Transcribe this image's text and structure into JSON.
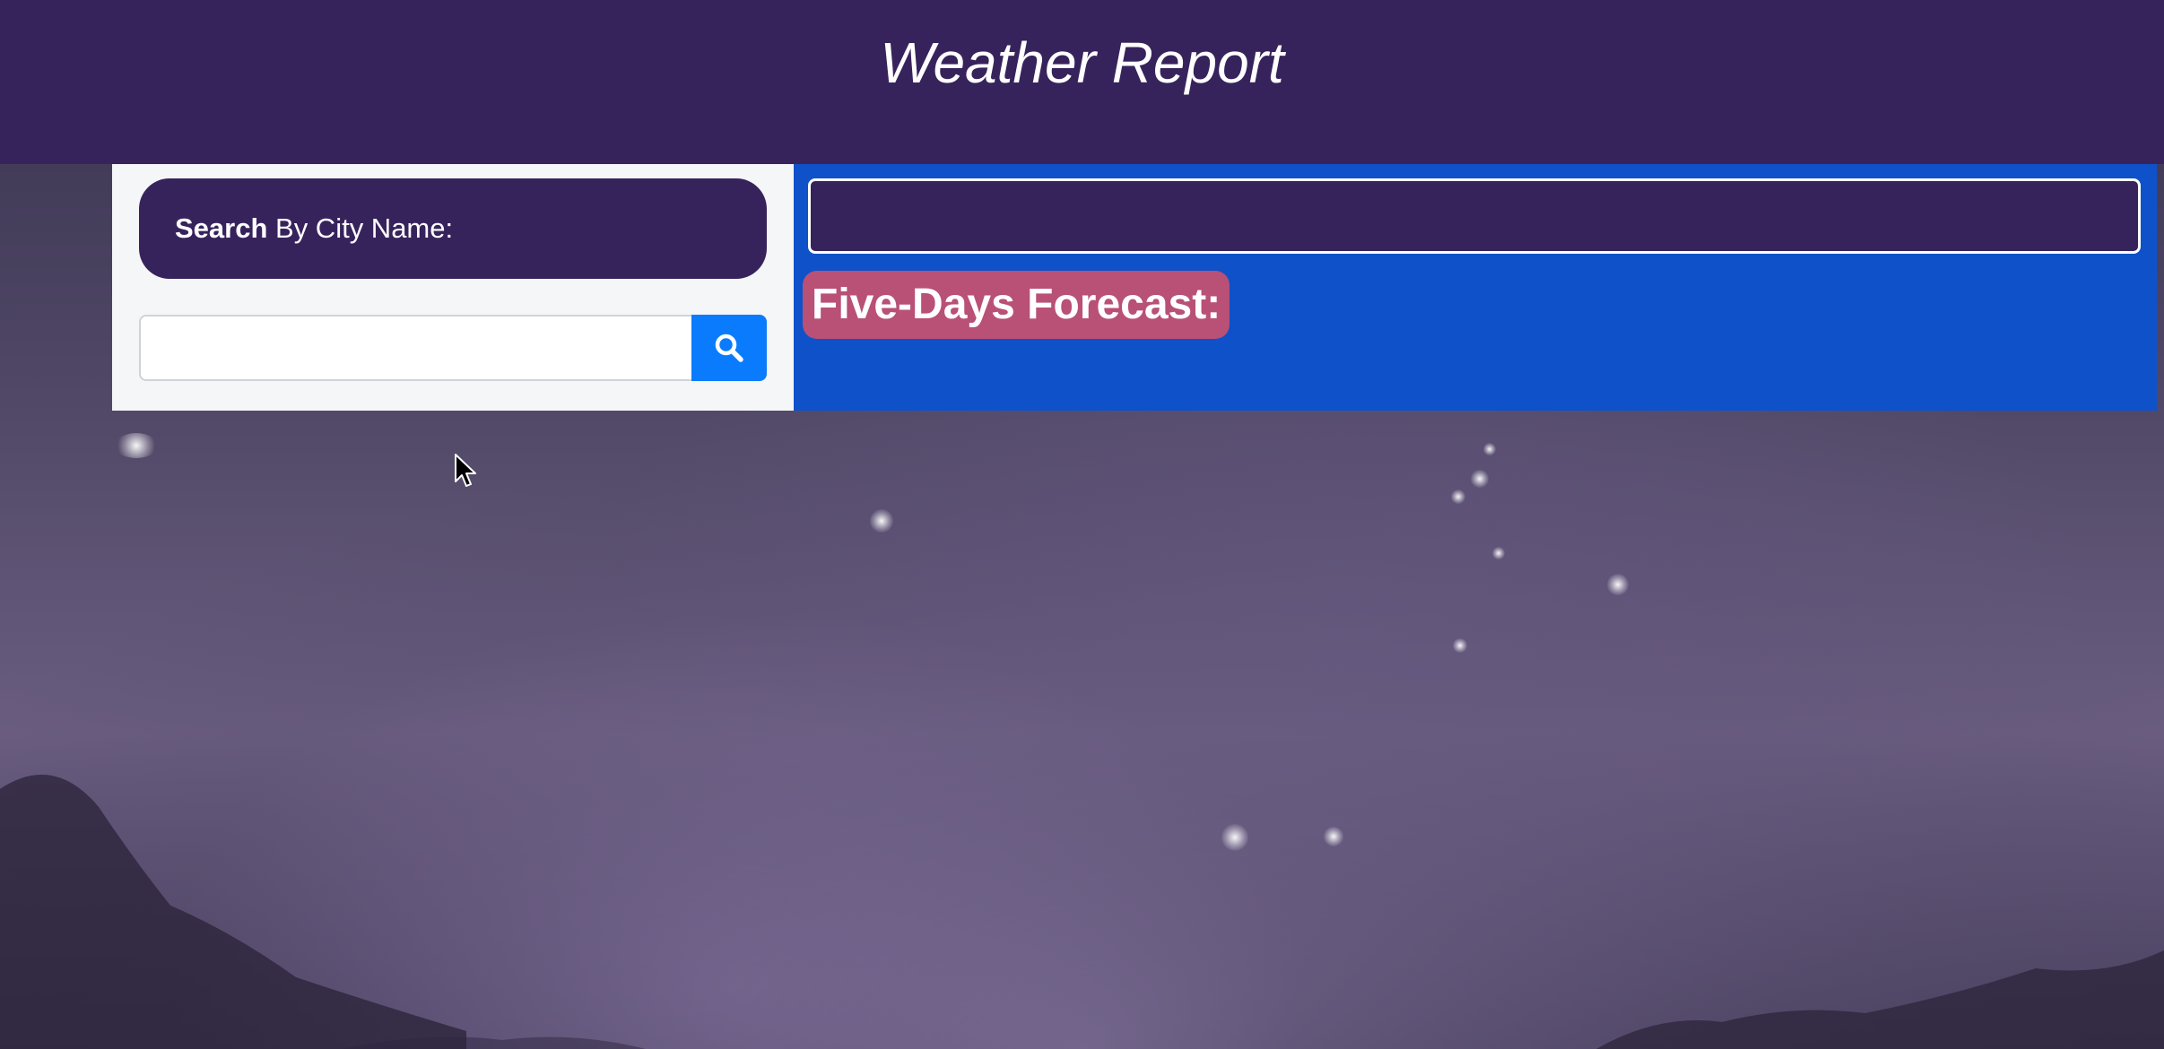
{
  "header": {
    "title": "Weather Report"
  },
  "search": {
    "label_bold": "Search",
    "label_rest": " By City Name:",
    "input_value": "",
    "input_placeholder": "",
    "button_icon": "search-icon"
  },
  "forecast": {
    "city_display": "",
    "heading": "Five-Days Forecast:"
  },
  "colors": {
    "header_bg": "#37235c",
    "search_panel_bg": "#f5f6f8",
    "forecast_panel_bg": "#0f51c8",
    "forecast_badge_bg": "#b95076",
    "search_button_bg": "#0a7bfc"
  }
}
